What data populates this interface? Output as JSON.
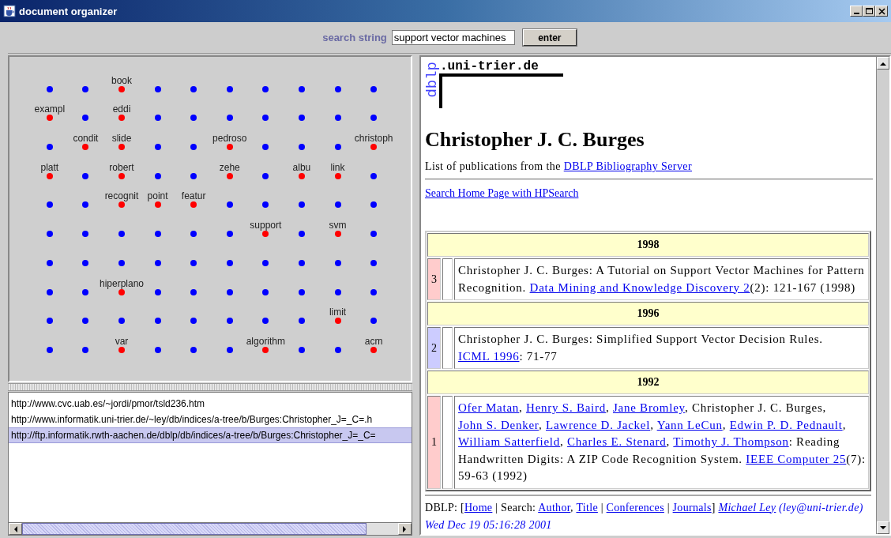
{
  "window": {
    "title": "document organizer"
  },
  "search": {
    "label": "search string",
    "value": "support vector machines",
    "button": "enter"
  },
  "term_map": {
    "rows": [
      [
        {
          "color": "#0000ff"
        },
        {
          "color": "#0000ff"
        },
        {
          "color": "#ff0000",
          "label": "book"
        },
        {
          "color": "#0000ff"
        },
        {
          "color": "#0000ff"
        },
        {
          "color": "#0000ff"
        },
        {
          "color": "#0000ff"
        },
        {
          "color": "#0000ff"
        },
        {
          "color": "#0000ff"
        },
        {
          "color": "#0000ff"
        }
      ],
      [
        {
          "color": "#ff0000",
          "label": "exampl"
        },
        {
          "color": "#0000ff"
        },
        {
          "color": "#ff0000",
          "label": "eddi"
        },
        {
          "color": "#0000ff"
        },
        {
          "color": "#0000ff"
        },
        {
          "color": "#0000ff"
        },
        {
          "color": "#0000ff"
        },
        {
          "color": "#0000ff"
        },
        {
          "color": "#0000ff"
        },
        {
          "color": "#0000ff"
        }
      ],
      [
        {
          "color": "#0000ff"
        },
        {
          "color": "#ff0000",
          "label": "condit"
        },
        {
          "color": "#ff0000",
          "label": "slide"
        },
        {
          "color": "#0000ff"
        },
        {
          "color": "#0000ff"
        },
        {
          "color": "#ff0000",
          "label": "pedroso"
        },
        {
          "color": "#0000ff"
        },
        {
          "color": "#0000ff"
        },
        {
          "color": "#0000ff"
        },
        {
          "color": "#ff0000",
          "label": "christoph"
        }
      ],
      [
        {
          "color": "#ff0000",
          "label": "platt"
        },
        {
          "color": "#0000ff"
        },
        {
          "color": "#ff0000",
          "label": "robert"
        },
        {
          "color": "#0000ff"
        },
        {
          "color": "#0000ff"
        },
        {
          "color": "#ff0000",
          "label": "zehe"
        },
        {
          "color": "#0000ff"
        },
        {
          "color": "#ff0000",
          "label": "albu"
        },
        {
          "color": "#ff0000",
          "label": "link"
        },
        {
          "color": "#0000ff"
        }
      ],
      [
        {
          "color": "#0000ff"
        },
        {
          "color": "#0000ff"
        },
        {
          "color": "#ff0000",
          "label": "recognit"
        },
        {
          "color": "#ff0000",
          "label": "point"
        },
        {
          "color": "#ff0000",
          "label": "featur"
        },
        {
          "color": "#0000ff"
        },
        {
          "color": "#0000ff"
        },
        {
          "color": "#0000ff"
        },
        {
          "color": "#0000ff"
        },
        {
          "color": "#0000ff"
        }
      ],
      [
        {
          "color": "#0000ff"
        },
        {
          "color": "#0000ff"
        },
        {
          "color": "#0000ff"
        },
        {
          "color": "#0000ff"
        },
        {
          "color": "#0000ff"
        },
        {
          "color": "#0000ff"
        },
        {
          "color": "#ff0000",
          "label": "support"
        },
        {
          "color": "#0000ff"
        },
        {
          "color": "#ff0000",
          "label": "svm"
        },
        {
          "color": "#0000ff"
        }
      ],
      [
        {
          "color": "#0000ff"
        },
        {
          "color": "#0000ff"
        },
        {
          "color": "#0000ff"
        },
        {
          "color": "#0000ff"
        },
        {
          "color": "#0000ff"
        },
        {
          "color": "#0000ff"
        },
        {
          "color": "#0000ff"
        },
        {
          "color": "#0000ff"
        },
        {
          "color": "#0000ff"
        },
        {
          "color": "#0000ff"
        }
      ],
      [
        {
          "color": "#0000ff"
        },
        {
          "color": "#0000ff"
        },
        {
          "color": "#ff0000",
          "label": "hiperplano"
        },
        {
          "color": "#0000ff"
        },
        {
          "color": "#0000ff"
        },
        {
          "color": "#0000ff"
        },
        {
          "color": "#0000ff"
        },
        {
          "color": "#0000ff"
        },
        {
          "color": "#0000ff"
        },
        {
          "color": "#0000ff"
        }
      ],
      [
        {
          "color": "#0000ff"
        },
        {
          "color": "#0000ff"
        },
        {
          "color": "#0000ff"
        },
        {
          "color": "#0000ff"
        },
        {
          "color": "#0000ff"
        },
        {
          "color": "#0000ff"
        },
        {
          "color": "#0000ff"
        },
        {
          "color": "#0000ff"
        },
        {
          "color": "#ff0000",
          "label": "limit"
        },
        {
          "color": "#0000ff"
        }
      ],
      [
        {
          "color": "#0000ff"
        },
        {
          "color": "#0000ff"
        },
        {
          "color": "#ff0000",
          "label": "var"
        },
        {
          "color": "#0000ff"
        },
        {
          "color": "#0000ff"
        },
        {
          "color": "#0000ff"
        },
        {
          "color": "#ff0000",
          "label": "algorithm"
        },
        {
          "color": "#0000ff"
        },
        {
          "color": "#0000ff"
        },
        {
          "color": "#ff0000",
          "label": "acm"
        }
      ]
    ]
  },
  "url_list": {
    "items": [
      {
        "url": "http://www.cvc.uab.es/~jordi/pmor/tsld236.htm",
        "selected": false
      },
      {
        "url": "http://www.informatik.uni-trier.de/~ley/db/indices/a-tree/b/Burges:Christopher_J=_C=.h",
        "selected": false
      },
      {
        "url": "http://ftp.informatik.rwth-aachen.de/dblp/db/indices/a-tree/b/Burges:Christopher_J=_C=",
        "selected": true
      }
    ]
  },
  "browser": {
    "logo_side": "dblp",
    "logo_domain": ".uni-trier.de",
    "heading": "Christopher J. C. Burges",
    "intro": [
      {
        "kind": "text",
        "text": "List of publications from the "
      },
      {
        "kind": "link",
        "text": "DBLP Bibliography Server"
      }
    ],
    "search_link": "Search Home Page with HPSearch",
    "years": [
      {
        "year": "1998",
        "publications": [
          {
            "number": "3",
            "color": "#ffcccc",
            "text": [
              {
                "kind": "text",
                "text": "Christopher J. C. Burges: A Tutorial on Support Vector Machines for Pattern Recognition. "
              },
              {
                "kind": "link",
                "text": "Data Mining and Knowledge Discovery 2"
              },
              {
                "kind": "text",
                "text": "(2): 121-167 (1998)"
              }
            ]
          }
        ]
      },
      {
        "year": "1996",
        "publications": [
          {
            "number": "2",
            "color": "#ccccff",
            "text": [
              {
                "kind": "text",
                "text": "Christopher J. C. Burges: Simplified Support Vector Decision Rules. "
              },
              {
                "kind": "link",
                "text": "ICML 1996"
              },
              {
                "kind": "text",
                "text": ": 71-77"
              }
            ]
          }
        ]
      },
      {
        "year": "1992",
        "publications": [
          {
            "number": "1",
            "color": "#ffcccc",
            "text": [
              {
                "kind": "link",
                "text": "Ofer Matan"
              },
              {
                "kind": "text",
                "text": ", "
              },
              {
                "kind": "link",
                "text": "Henry S. Baird"
              },
              {
                "kind": "text",
                "text": ", "
              },
              {
                "kind": "link",
                "text": "Jane Bromley"
              },
              {
                "kind": "text",
                "text": ", Christopher J. C. Burges, "
              },
              {
                "kind": "link",
                "text": "John S. Denker"
              },
              {
                "kind": "text",
                "text": ", "
              },
              {
                "kind": "link",
                "text": "Lawrence D. Jackel"
              },
              {
                "kind": "text",
                "text": ", "
              },
              {
                "kind": "link",
                "text": "Yann LeCun"
              },
              {
                "kind": "text",
                "text": ", "
              },
              {
                "kind": "link",
                "text": "Edwin P. D. Pednault"
              },
              {
                "kind": "text",
                "text": ", "
              },
              {
                "kind": "link",
                "text": "William Satterfield"
              },
              {
                "kind": "text",
                "text": ", "
              },
              {
                "kind": "link",
                "text": "Charles E. Stenard"
              },
              {
                "kind": "text",
                "text": ", "
              },
              {
                "kind": "link",
                "text": "Timothy J. Thompson"
              },
              {
                "kind": "text",
                "text": ": Reading Handwritten Digits: A ZIP Code Recognition System. "
              },
              {
                "kind": "link",
                "text": "IEEE Computer 25"
              },
              {
                "kind": "text",
                "text": "(7): 59-63 (1992)"
              }
            ]
          }
        ]
      }
    ],
    "footer": [
      {
        "kind": "text",
        "text": "DBLP: ["
      },
      {
        "kind": "link",
        "text": "Home"
      },
      {
        "kind": "text",
        "text": " | Search: "
      },
      {
        "kind": "link",
        "text": "Author"
      },
      {
        "kind": "text",
        "text": ", "
      },
      {
        "kind": "link",
        "text": "Title"
      },
      {
        "kind": "text",
        "text": " | "
      },
      {
        "kind": "link",
        "text": "Conferences"
      },
      {
        "kind": "text",
        "text": " | "
      },
      {
        "kind": "link",
        "text": "Journals"
      },
      {
        "kind": "text",
        "text": "] "
      },
      {
        "kind": "signature-link",
        "text": "Michael Ley"
      },
      {
        "kind": "signature",
        "text": " (ley@uni-trier.de) Wed Dec 19 05:16:28 2001"
      }
    ]
  }
}
